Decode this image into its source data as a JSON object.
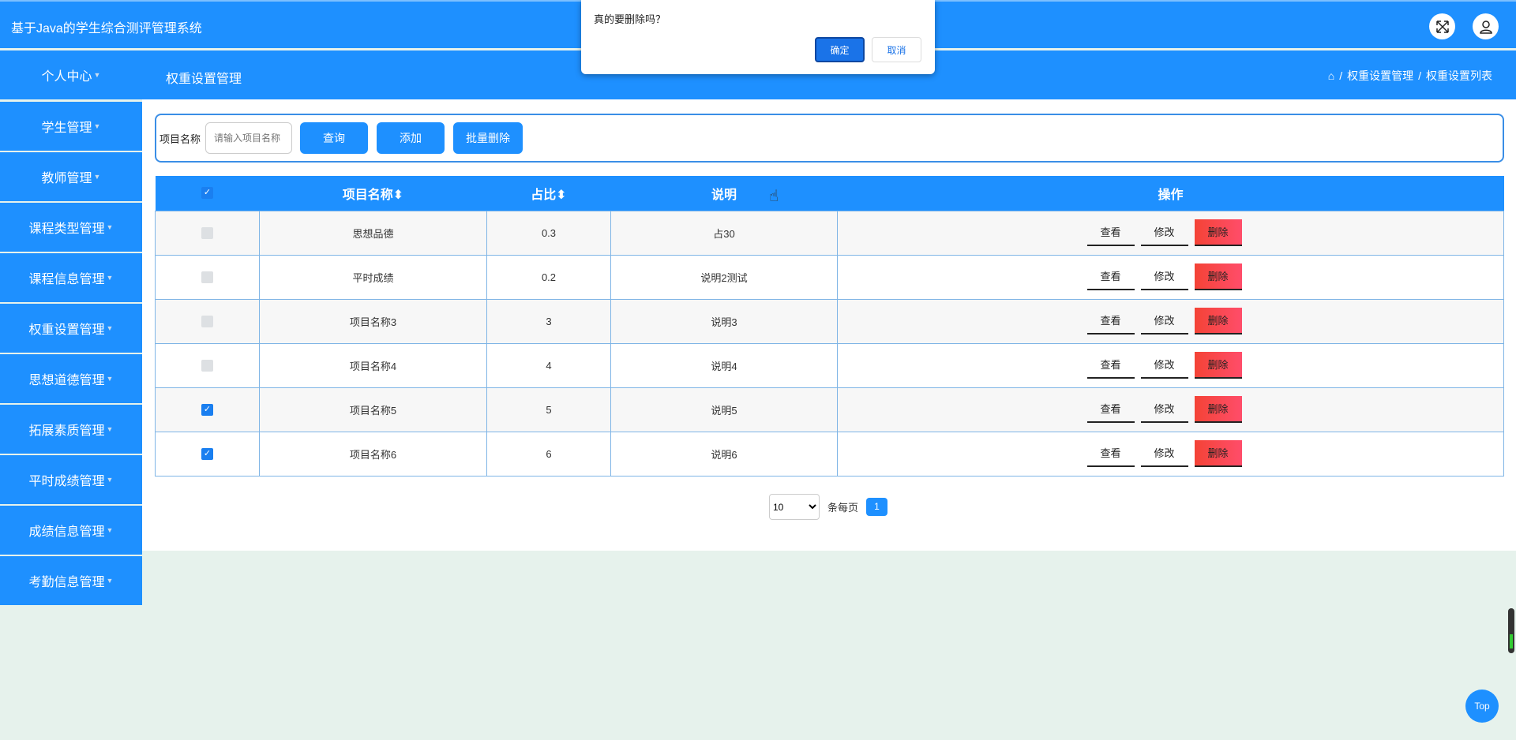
{
  "app_title": "基于Java的学生综合测评管理系统",
  "header_icons": [
    "fullscreen-icon",
    "user-icon"
  ],
  "page_title": "权重设置管理",
  "breadcrumb": [
    "权重设置管理",
    "权重设置列表"
  ],
  "sidebar": [
    "个人中心",
    "学生管理",
    "教师管理",
    "课程类型管理",
    "课程信息管理",
    "权重设置管理",
    "思想道德管理",
    "拓展素质管理",
    "平时成绩管理",
    "成绩信息管理",
    "考勤信息管理"
  ],
  "search": {
    "label": "项目名称",
    "placeholder": "请输入项目名称",
    "query": "查询",
    "add": "添加",
    "batch_delete": "批量删除"
  },
  "table": {
    "headers": [
      "项目名称",
      "占比",
      "说明",
      "操作"
    ],
    "sort_icon": "⬍",
    "header_checked": true,
    "rows": [
      {
        "checked": false,
        "name": "思想品德",
        "ratio": "0.3",
        "desc": "占30"
      },
      {
        "checked": false,
        "name": "平时成绩",
        "ratio": "0.2",
        "desc": "说明2测试"
      },
      {
        "checked": false,
        "name": "项目名称3",
        "ratio": "3",
        "desc": "说明3"
      },
      {
        "checked": false,
        "name": "项目名称4",
        "ratio": "4",
        "desc": "说明4"
      },
      {
        "checked": true,
        "name": "项目名称5",
        "ratio": "5",
        "desc": "说明5"
      },
      {
        "checked": true,
        "name": "项目名称6",
        "ratio": "6",
        "desc": "说明6"
      }
    ],
    "actions": {
      "view": "查看",
      "edit": "修改",
      "delete": "删除"
    }
  },
  "pager": {
    "page_size": "10",
    "per_page_label": "条每页",
    "current_page": "1"
  },
  "dialog": {
    "message": "真的要删除吗？",
    "ok": "确定",
    "cancel": "取消"
  },
  "top_button": "Top"
}
